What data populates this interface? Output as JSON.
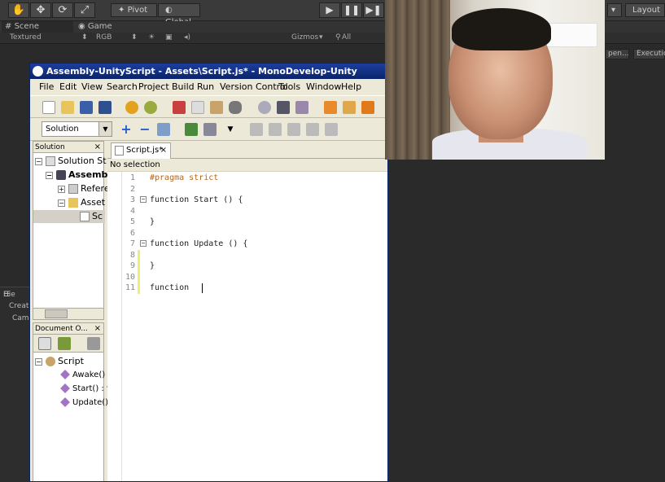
{
  "unity": {
    "toolbar": {
      "pivot": "Pivot",
      "global": "Global",
      "layout": "Layout"
    },
    "tabs": {
      "scene": "Scene",
      "game": "Game"
    },
    "scene_bar": {
      "shading": "Textured",
      "color_mode": "RGB",
      "gizmos": "Gizmos",
      "search_all": "All"
    },
    "right_buttons": {
      "open": "pen...",
      "execution": "Executio"
    },
    "hierarchy": {
      "tab": "Hie",
      "create": "Creat",
      "camera": "Cam"
    }
  },
  "monodevelop": {
    "title": "Assembly-UnityScript - Assets\\Script.js* - MonoDevelop-Unity",
    "menu": [
      "File",
      "Edit",
      "View",
      "Search",
      "Project",
      "Build",
      "Run",
      "Version Control",
      "Tools",
      "Window",
      "Help"
    ],
    "config_select": "Solution",
    "solution_pane": {
      "header": "Solution",
      "items": [
        {
          "label": "Solution St",
          "level": 0
        },
        {
          "label": "Assemb",
          "level": 1
        },
        {
          "label": "Refere",
          "level": 2
        },
        {
          "label": "Asset",
          "level": 2
        },
        {
          "label": "Sc",
          "level": 3
        }
      ]
    },
    "outline_pane": {
      "header": "Document O...",
      "root": "Script",
      "members": [
        "Awake() : v",
        "Start() : vc",
        "Update() :"
      ]
    },
    "editor": {
      "tab": "Script.js*",
      "status": "No selection",
      "lines": [
        "#pragma strict",
        "",
        "function Start () {",
        "",
        "}",
        "",
        "function Update () {",
        "",
        "}",
        "",
        "function "
      ]
    }
  }
}
